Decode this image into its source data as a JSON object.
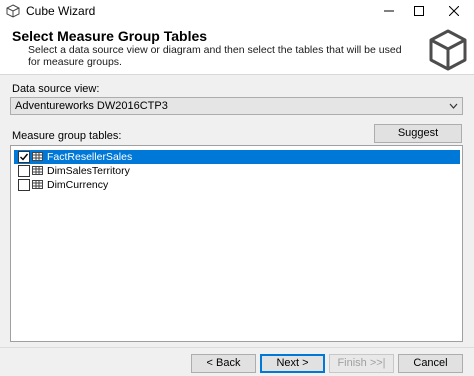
{
  "window": {
    "title": "Cube Wizard"
  },
  "header": {
    "title": "Select Measure Group Tables",
    "description": "Select a data source view or diagram and then select the tables that will be used for measure groups."
  },
  "dsv": {
    "label": "Data source view:",
    "value": "Adventureworks DW2016CTP3"
  },
  "tables": {
    "label": "Measure group tables:",
    "suggest_label": "Suggest",
    "items": [
      {
        "label": "FactResellerSales",
        "checked": true,
        "selected": true
      },
      {
        "label": "DimSalesTerritory",
        "checked": false,
        "selected": false
      },
      {
        "label": "DimCurrency",
        "checked": false,
        "selected": false
      }
    ]
  },
  "footer": {
    "back_label": "< Back",
    "next_label": "Next >",
    "finish_label": "Finish >>|",
    "cancel_label": "Cancel"
  }
}
